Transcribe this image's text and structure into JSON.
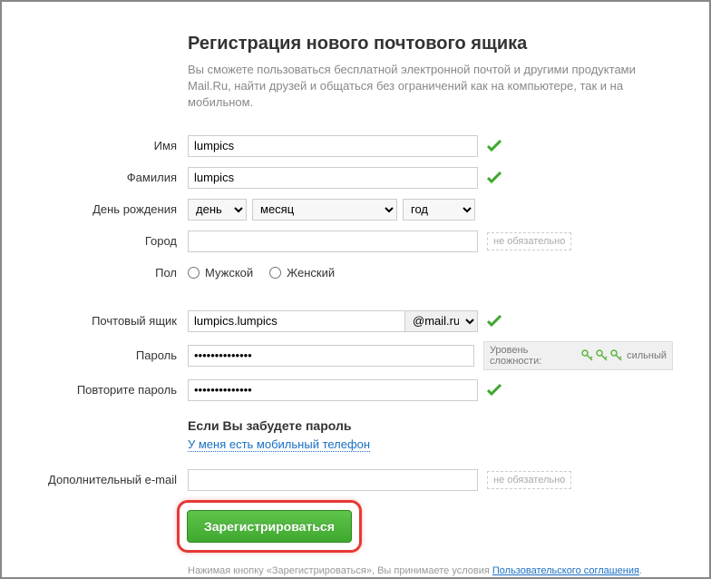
{
  "header": {
    "title": "Регистрация нового почтового ящика",
    "subtitle": "Вы сможете пользоваться бесплатной электронной почтой и другими продуктами Mail.Ru, найти друзей и общаться без ограничений как на компьютере, так и на мобильном."
  },
  "labels": {
    "firstname": "Имя",
    "lastname": "Фамилия",
    "birthday": "День рождения",
    "city": "Город",
    "gender": "Пол",
    "mailbox": "Почтовый ящик",
    "password": "Пароль",
    "password_repeat": "Повторите пароль",
    "extra_email": "Дополнительный e-mail"
  },
  "values": {
    "firstname": "lumpics",
    "lastname": "lumpics",
    "city": "",
    "mailbox": "lumpics.lumpics",
    "password": "••••••••••••••",
    "password_repeat": "••••••••••••••",
    "extra_email": ""
  },
  "birthday": {
    "day": "день",
    "month": "месяц",
    "year": "год"
  },
  "gender": {
    "male": "Мужской",
    "female": "Женский"
  },
  "domain": "@mail.ru",
  "optional_text": "не обязательно",
  "strength": {
    "label": "Уровень сложности:",
    "value": "сильный"
  },
  "forgot": {
    "title": "Если Вы забудете пароль",
    "link": "У меня есть мобильный телефон"
  },
  "submit": "Зарегистрироваться",
  "legal": {
    "prefix": "Нажимая кнопку «Зарегистрироваться», Вы принимаете условия ",
    "link": "Пользовательского соглашения"
  }
}
